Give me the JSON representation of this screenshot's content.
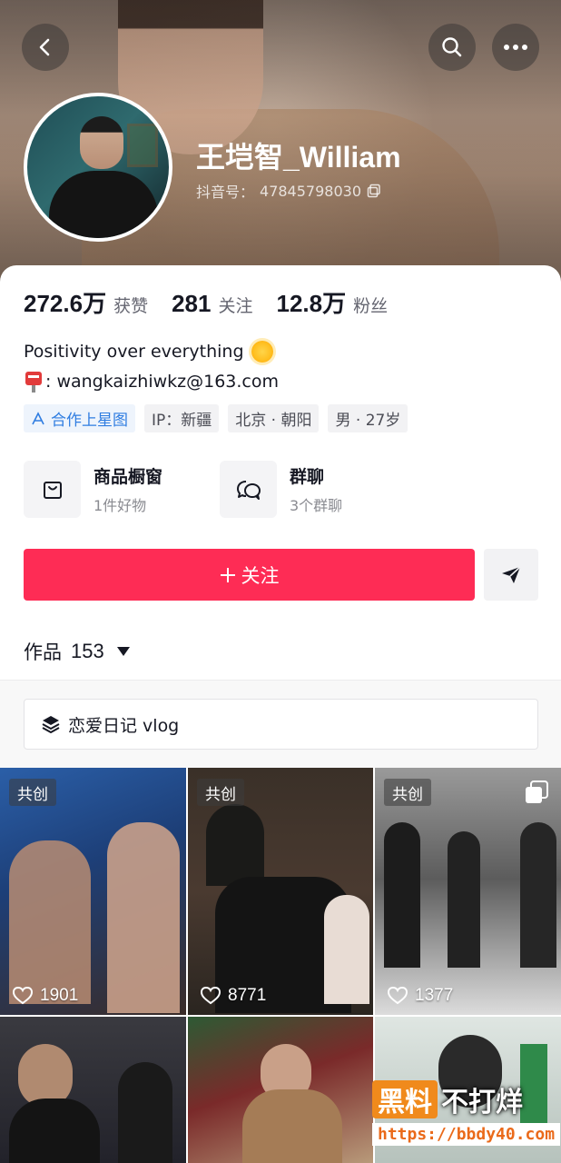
{
  "header": {
    "name": "王垲智_William",
    "douyin_id_label": "抖音号：",
    "douyin_id": "47845798030"
  },
  "stats": [
    {
      "value": "272.6万",
      "label": "获赞"
    },
    {
      "value": "281",
      "label": "关注"
    },
    {
      "value": "12.8万",
      "label": "粉丝"
    }
  ],
  "bio": {
    "line1": "Positivity over everything",
    "line2": ": wangkaizhiwkz@163.com"
  },
  "tags": [
    {
      "label": "合作上星图",
      "icon": "star-chart-icon"
    },
    {
      "label": "IP：新疆"
    },
    {
      "label": "北京 · 朝阳"
    },
    {
      "label": "男 · 27岁"
    }
  ],
  "features": [
    {
      "title": "商品橱窗",
      "subtitle": "1件好物",
      "icon": "shopping-bag-icon"
    },
    {
      "title": "群聊",
      "subtitle": "3个群聊",
      "icon": "chat-bubbles-icon"
    }
  ],
  "actions": {
    "follow_label": "关注",
    "follow_color": "#fe2c55"
  },
  "works": {
    "label": "作品",
    "count": "153"
  },
  "collection": {
    "label": "恋爱日记 vlog"
  },
  "videos": [
    {
      "badge": "共创",
      "likes": "1901"
    },
    {
      "badge": "共创",
      "likes": "8771"
    },
    {
      "badge": "共创",
      "likes": "1377"
    },
    {
      "badge": "",
      "likes": ""
    },
    {
      "badge": "",
      "likes": ""
    },
    {
      "badge": "",
      "likes": ""
    }
  ],
  "watermark": {
    "badge": "黑料",
    "text": "不打烊",
    "url": "https://bbdy40.com"
  }
}
